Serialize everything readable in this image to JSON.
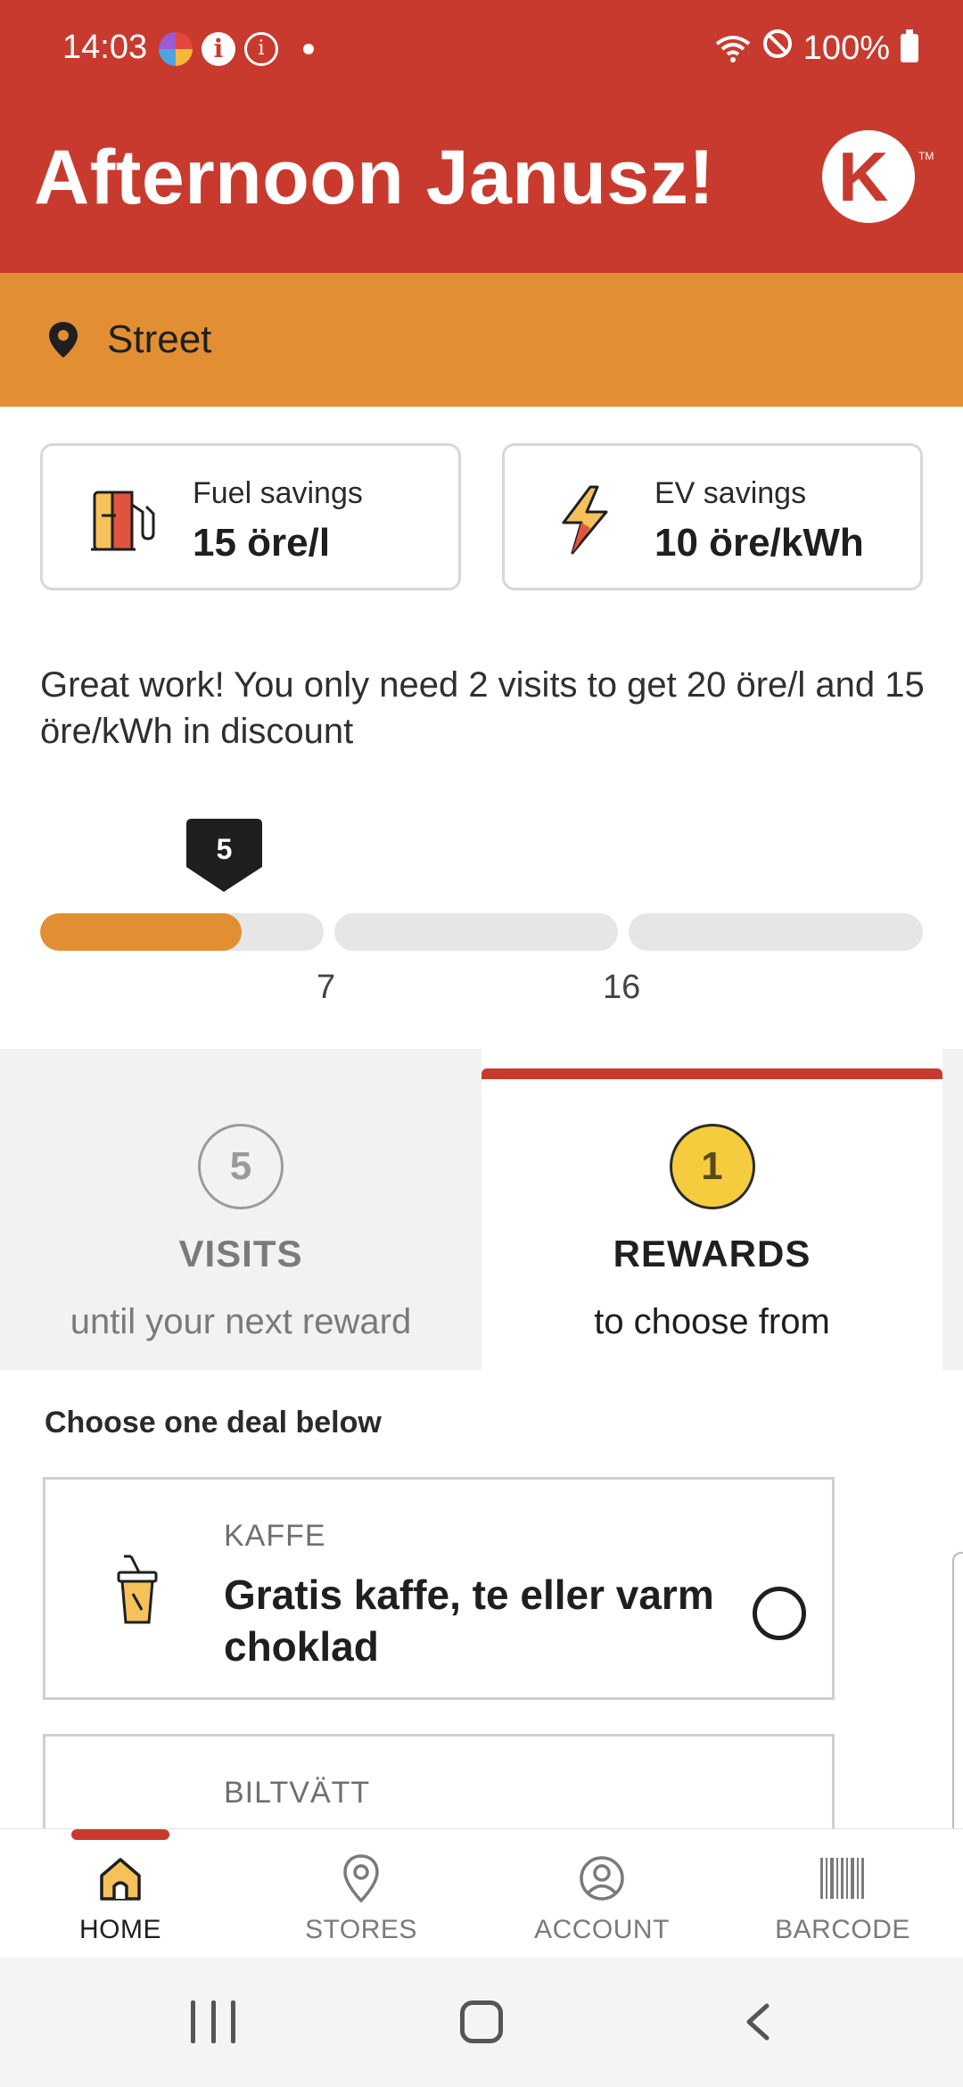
{
  "status_bar": {
    "time": "14:03",
    "battery": "100%"
  },
  "header": {
    "greeting": "Afternoon Janusz!",
    "logo_letter": "K",
    "logo_tm": "TM"
  },
  "location": {
    "label": "Street"
  },
  "savings": {
    "fuel": {
      "label": "Fuel savings",
      "value": "15 öre/l",
      "icon": "fuel-pump-icon"
    },
    "ev": {
      "label": "EV savings",
      "value": "10 öre/kWh",
      "icon": "lightning-icon"
    }
  },
  "message": "Great work! You only need 2 visits to get 20 öre/l and 15 öre/kWh in discount",
  "progress": {
    "current": "5",
    "segments": [
      {
        "fill": 0.71
      },
      {
        "fill": 0
      },
      {
        "fill": 0
      }
    ],
    "ticks": [
      "7",
      "16"
    ]
  },
  "tabs": {
    "visits": {
      "count": "5",
      "title": "VISITS",
      "subtitle": "until your next reward"
    },
    "rewards": {
      "count": "1",
      "title": "REWARDS",
      "subtitle": "to choose from"
    }
  },
  "deals_heading": "Choose one deal below",
  "deals": [
    {
      "category": "KAFFE",
      "title": "Gratis kaffe, te eller varm choklad",
      "icon": "coffee-cup-icon"
    },
    {
      "category": "BILTVÄTT",
      "title": ""
    }
  ],
  "bottom_nav": [
    {
      "label": "HOME",
      "icon": "home-icon",
      "active": true
    },
    {
      "label": "STORES",
      "icon": "location-pin-icon"
    },
    {
      "label": "ACCOUNT",
      "icon": "account-icon"
    },
    {
      "label": "BARCODE",
      "icon": "barcode-icon"
    }
  ],
  "colors": {
    "brand_red": "#c93a2e",
    "accent_orange": "#e28f33",
    "reward_yellow": "#f5cc3d"
  }
}
